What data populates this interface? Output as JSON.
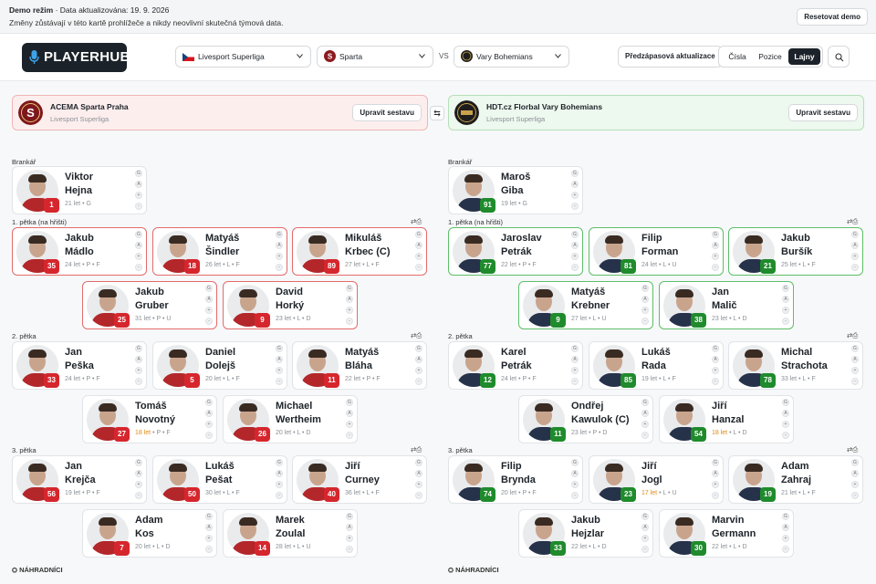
{
  "banner": {
    "mode_label": "Demo režim",
    "data_updated": "· Data aktualizována: 19. 9. 2026",
    "note": "Změny zůstávají v této kartě prohlížeče a nikdy neovlivní skutečná týmová data.",
    "reset_label": "Resetovat demo"
  },
  "header": {
    "logo_text": "PLAYERHUB",
    "league": "Livesport Superliga",
    "home_team": "Sparta",
    "vs": "VS",
    "away_team": "Vary Bohemians",
    "pre_match_label": "Předzápasová aktualizace",
    "view_tabs": [
      "Čísla",
      "Pozice",
      "Lajny"
    ],
    "active_view": "Lajny"
  },
  "teams": {
    "home": {
      "name": "ACEMA Sparta Praha",
      "league": "Livesport Superliga",
      "edit_label": "Upravit sestavu",
      "color": "#d6262d"
    },
    "away": {
      "name": "HDT.cz Florbal Vary Bohemians",
      "league": "Livesport Superliga",
      "edit_label": "Upravit sestavu",
      "color": "#1f8b2c"
    }
  },
  "skill_letters": [
    "G",
    "A",
    "+",
    "-"
  ],
  "sections": {
    "goalie": "Brankář",
    "line1": "1. pětka (na hřišti)",
    "line2": "2. pětka",
    "line3": "3. pětka",
    "bench": "NÁHRADNÍCI"
  },
  "home_players": {
    "goalie": [
      {
        "first": "Viktor",
        "last": "Hejna",
        "number": "1",
        "age": "21 let",
        "pos": "G"
      }
    ],
    "line1": [
      {
        "first": "Jakub",
        "last": "Mádlo",
        "number": "35",
        "age": "24 let",
        "pos": "P • F"
      },
      {
        "first": "Matyáš",
        "last": "Šindler",
        "number": "18",
        "age": "26 let",
        "pos": "L • F"
      },
      {
        "first": "Mikuláš",
        "last": "Krbec (C)",
        "number": "89",
        "age": "27 let",
        "pos": "L • F"
      },
      {
        "first": "Jakub",
        "last": "Gruber",
        "number": "25",
        "age": "31 let",
        "pos": "P • U"
      },
      {
        "first": "David",
        "last": "Horký",
        "number": "9",
        "age": "23 let",
        "pos": "L • D"
      }
    ],
    "line2": [
      {
        "first": "Jan",
        "last": "Peška",
        "number": "33",
        "age": "24 let",
        "pos": "P • F"
      },
      {
        "first": "Daniel",
        "last": "Dolejš",
        "number": "5",
        "age": "20 let",
        "pos": "L • F"
      },
      {
        "first": "Matyáš",
        "last": "Bláha",
        "number": "11",
        "age": "22 let",
        "pos": "P • F"
      },
      {
        "first": "Tomáš",
        "last": "Novotný",
        "number": "27",
        "age": "18 let",
        "pos": "P • F"
      },
      {
        "first": "Michael",
        "last": "Wertheim",
        "number": "26",
        "age": "20 let",
        "pos": "L • D"
      }
    ],
    "line3": [
      {
        "first": "Jan",
        "last": "Krejča",
        "number": "56",
        "age": "19 let",
        "pos": "P • F"
      },
      {
        "first": "Lukáš",
        "last": "Pešat",
        "number": "50",
        "age": "30 let",
        "pos": "L • F"
      },
      {
        "first": "Jiří",
        "last": "Curney",
        "number": "40",
        "age": "36 let",
        "pos": "L • F"
      },
      {
        "first": "Adam",
        "last": "Kos",
        "number": "7",
        "age": "20 let",
        "pos": "L • D"
      },
      {
        "first": "Marek",
        "last": "Zoulal",
        "number": "14",
        "age": "28 let",
        "pos": "L • U"
      }
    ]
  },
  "away_players": {
    "goalie": [
      {
        "first": "Maroš",
        "last": "Giba",
        "number": "91",
        "age": "19 let",
        "pos": "G"
      }
    ],
    "line1": [
      {
        "first": "Jaroslav",
        "last": "Petrák",
        "number": "77",
        "age": "22 let",
        "pos": "P • F"
      },
      {
        "first": "Filip",
        "last": "Forman",
        "number": "81",
        "age": "24 let",
        "pos": "L • U"
      },
      {
        "first": "Jakub",
        "last": "Buršík",
        "number": "21",
        "age": "25 let",
        "pos": "L • F"
      },
      {
        "first": "Matyáš",
        "last": "Krebner",
        "number": "9",
        "age": "27 let",
        "pos": "L • U"
      },
      {
        "first": "Jan",
        "last": "Malič",
        "number": "38",
        "age": "23 let",
        "pos": "L • D"
      }
    ],
    "line2": [
      {
        "first": "Karel",
        "last": "Petrák",
        "number": "12",
        "age": "24 let",
        "pos": "P • F"
      },
      {
        "first": "Lukáš",
        "last": "Rada",
        "number": "85",
        "age": "19 let",
        "pos": "L • F"
      },
      {
        "first": "Michal",
        "last": "Strachota",
        "number": "78",
        "age": "33 let",
        "pos": "L • F"
      },
      {
        "first": "Ondřej",
        "last": "Kawulok (C)",
        "number": "11",
        "age": "23 let",
        "pos": "P • D"
      },
      {
        "first": "Jiří",
        "last": "Hanzal",
        "number": "54",
        "age": "18 let",
        "pos": "L • D"
      }
    ],
    "line3": [
      {
        "first": "Filip",
        "last": "Brynda",
        "number": "74",
        "age": "20 let",
        "pos": "P • F"
      },
      {
        "first": "Jiří",
        "last": "Jogl",
        "number": "23",
        "age": "17 let",
        "pos": "L • U"
      },
      {
        "first": "Adam",
        "last": "Zahraj",
        "number": "19",
        "age": "21 let",
        "pos": "L • F"
      },
      {
        "first": "Jakub",
        "last": "Hejzlar",
        "number": "33",
        "age": "22 let",
        "pos": "L • D"
      },
      {
        "first": "Marvin",
        "last": "Germann",
        "number": "30",
        "age": "22 let",
        "pos": "L • D"
      }
    ]
  }
}
